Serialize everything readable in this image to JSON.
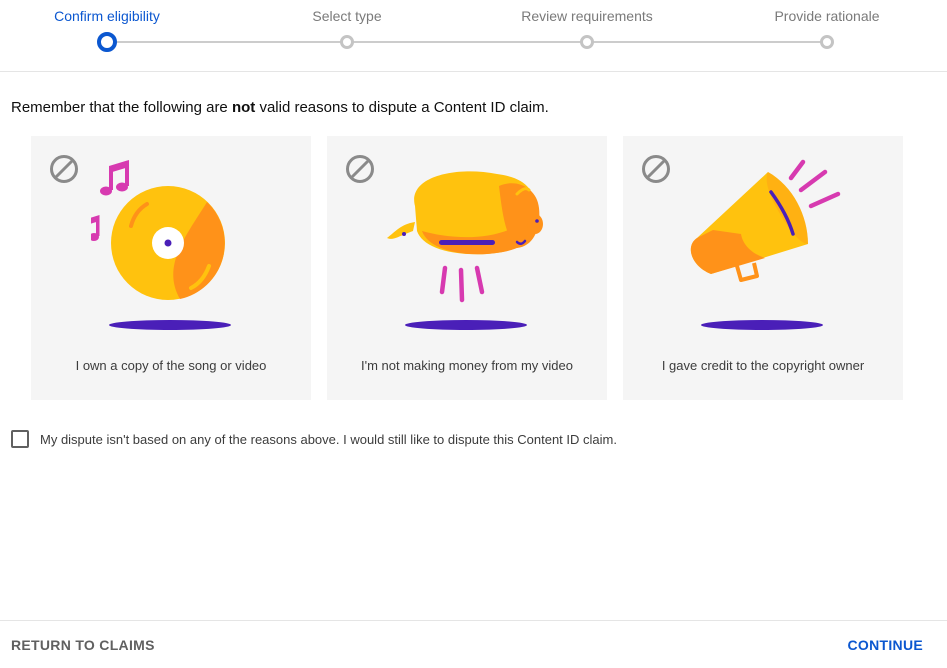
{
  "stepper": {
    "steps": [
      {
        "label": "Confirm eligibility",
        "state": "active"
      },
      {
        "label": "Select type",
        "state": "upcoming"
      },
      {
        "label": "Review requirements",
        "state": "upcoming"
      },
      {
        "label": "Provide rationale",
        "state": "upcoming"
      }
    ]
  },
  "intro": {
    "before": "Remember that the following are ",
    "bold": "not",
    "after": " valid reasons to dispute a Content ID claim."
  },
  "cards": [
    {
      "caption": "I own a copy of the song or video",
      "icon": "prohibited-icon",
      "illustration": "music-record"
    },
    {
      "caption": "I'm not making money from my video",
      "icon": "prohibited-icon",
      "illustration": "piggy-bank"
    },
    {
      "caption": "I gave credit to the copyright owner",
      "icon": "prohibited-icon",
      "illustration": "megaphone"
    }
  ],
  "checkbox": {
    "label": "My dispute isn't based on any of the reasons above. I would still like to dispute this Content ID claim.",
    "checked": false
  },
  "footer": {
    "return_label": "RETURN TO CLAIMS",
    "continue_label": "CONTINUE"
  },
  "colors": {
    "accent": "#0b57d0",
    "yellow": "#ffc20e",
    "orange": "#ff9219",
    "magenta": "#d73ab0",
    "purple": "#4a1fb8"
  }
}
